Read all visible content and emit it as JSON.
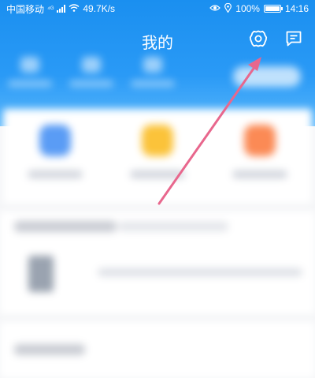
{
  "status_bar": {
    "carrier": "中国移动",
    "net_type": "⁴ᴳ",
    "speed": "49.7K/s",
    "battery": "100%",
    "battery_level": 1.0,
    "time": "14:16"
  },
  "header": {
    "title": "我的",
    "settings_icon": "gear-icon",
    "message_icon": "message-icon",
    "color": "#1a8ff0"
  },
  "annotation": {
    "arrow_color": "#e8678d"
  },
  "card": {
    "icon_colors": [
      "#5a9cf5",
      "#fbc33a",
      "#fb8a55"
    ]
  }
}
